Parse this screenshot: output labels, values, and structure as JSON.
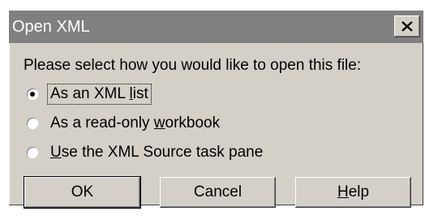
{
  "window": {
    "title": "Open XML",
    "close_icon": "close-icon"
  },
  "prompt": "Please select how you would like to open this file:",
  "options": [
    {
      "pre": "As an XML ",
      "accel": "l",
      "post": "ist",
      "selected": true
    },
    {
      "pre": "As a read-only ",
      "accel": "w",
      "post": "orkbook",
      "selected": false
    },
    {
      "pre": "",
      "accel": "U",
      "post": "se the XML Source task pane",
      "selected": false
    }
  ],
  "buttons": {
    "ok": "OK",
    "cancel": "Cancel",
    "help_accel": "H",
    "help_rest": "elp"
  },
  "colors": {
    "dialog_face": "#d4d0c8",
    "titlebar_inactive": "#808080",
    "title_text": "#ffffff"
  }
}
